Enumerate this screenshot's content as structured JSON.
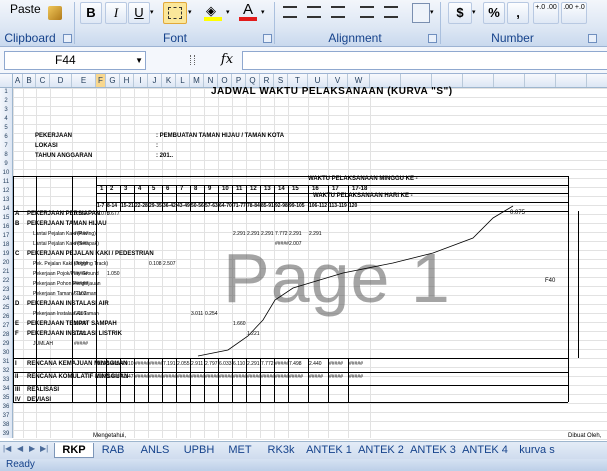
{
  "ribbon": {
    "paste_label": "Paste",
    "bold": "B",
    "italic": "I",
    "underline": "U",
    "font_color_glyph": "A",
    "groups": {
      "clipboard": "Clipboard",
      "font": "Font",
      "alignment": "Alignment",
      "number": "Number"
    },
    "number_buttons": {
      "currency": "$",
      "percent": "%",
      "comma": ",",
      "inc_dec": "+.0 .00",
      "dec_dec": ".00 +.0"
    }
  },
  "formula_bar": {
    "name_box": "F44",
    "fx": "fx",
    "formula": ""
  },
  "columns": [
    "A",
    "B",
    "C",
    "D",
    "E",
    "F",
    "G",
    "H",
    "I",
    "J",
    "K",
    "L",
    "M",
    "N",
    "O",
    "P",
    "Q",
    "R",
    "S",
    "T",
    "U",
    "V",
    "W"
  ],
  "rows": [
    "1",
    "2",
    "3",
    "4",
    "5",
    "6",
    "7",
    "8",
    "9",
    "10",
    "11",
    "12",
    "13",
    "14",
    "15",
    "16",
    "17",
    "18",
    "19",
    "20",
    "21",
    "22",
    "23",
    "24",
    "25",
    "26",
    "27",
    "28",
    "29",
    "30",
    "31",
    "32",
    "33",
    "34",
    "35",
    "36",
    "37",
    "38",
    "39"
  ],
  "sheet": {
    "title": "JADWAL WAKTU PELAKSANAAN (KURVA \"S\")",
    "info": [
      {
        "label": "PEKERJAAN",
        "value": ": PEMBUATAN TAMAN HIJAU / TAMAN KOTA"
      },
      {
        "label": "LOKASI",
        "value": ":"
      },
      {
        "label": "TAHUN ANGGARAN",
        "value": ": 201.."
      }
    ],
    "hdr_week": "WAKTU PELAKSANAAN MINGGU KE -",
    "hdr_day": "WAKTU PELAKSANAAN HARI KE -",
    "weeks": [
      "1",
      "2",
      "3",
      "4",
      "5",
      "6",
      "7",
      "8",
      "9",
      "10",
      "11",
      "12",
      "13",
      "14",
      "15",
      "16",
      "17",
      "17-18"
    ],
    "days": [
      "1-7",
      "8-14",
      "15-21",
      "22-28",
      "29-35",
      "36-42",
      "43-49",
      "50-56",
      "57-63",
      "64-70",
      "71-77",
      "78-84",
      "85-91",
      "92-98",
      "99-105",
      "106-112",
      "113-119",
      "120"
    ],
    "items": [
      {
        "no": "A",
        "name": "PEKERJAAN PERSIAPAN",
        "w": "0.751",
        "v": [
          "0.075",
          "0.677"
        ]
      },
      {
        "no": "B",
        "name": "PEKERJAAN TAMAN HIJAU",
        "w": "",
        "v": []
      },
      {
        "no": "",
        "name": "Lantai Pejalan Kaki (Paving)",
        "w": "#####",
        "v": [
          "2.291",
          "2.291",
          "2.291",
          "7.772",
          "2.291",
          "2.291"
        ]
      },
      {
        "no": "",
        "name": "Lantai Pejalan Kaki (Setapak)",
        "w": "#####",
        "v": [
          "#####",
          "2.007"
        ]
      },
      {
        "no": "C",
        "name": "PEKERJAAN PEJALAN KAKI / PEDESTRIAN",
        "w": "",
        "v": []
      },
      {
        "no": "",
        "name": "Pek. Pejalan Kaki (Jogging Track)",
        "w": "#####",
        "v": [
          "0.108",
          "2.507"
        ]
      },
      {
        "no": "",
        "name": "Pekerjaan Pojok/Play Ground",
        "w": "#####",
        "v": [
          "1.050"
        ]
      },
      {
        "no": "",
        "name": "Pekerjaan Pohon Penghijauan",
        "w": "#####",
        "v": []
      },
      {
        "no": "",
        "name": "Pekerjaan Taman / Tanaman",
        "w": "6.102",
        "v": []
      },
      {
        "no": "D",
        "name": "PEKERJAAN INSTALASI AIR",
        "w": "",
        "v": []
      },
      {
        "no": "",
        "name": "Pekerjaan Instalasi Air Taman",
        "w": "6.116",
        "v": [
          "3.011",
          "0.254"
        ]
      },
      {
        "no": "E",
        "name": "PEKERJAAN TEMPAT SAMPAH",
        "w": "1.660",
        "v": [
          "1.660"
        ]
      },
      {
        "no": "F",
        "name": "PEKERJAAN INSTALASI LISTRIK",
        "w": "1.221",
        "v": [
          "1.221"
        ]
      },
      {
        "no": "",
        "name": "JUMLAH",
        "w": "#####",
        "v": []
      }
    ],
    "summary": [
      {
        "no": "I",
        "name": "RENCANA KEMAJUAN MINGGUAN",
        "v": [
          "0.075",
          "1.405",
          "4.910",
          "#####",
          "#####",
          "7.191",
          "2.055",
          "2.911",
          "2.797",
          "6.033",
          "6.110",
          "2.291",
          "7.772",
          "#####",
          "7.498",
          "2.440",
          "#####",
          "#####"
        ]
      },
      {
        "no": "II",
        "name": "RENCANA KOMULATIF MINGGUAN",
        "v": [
          "0.075",
          "1.476",
          "6.347",
          "#####",
          "#####",
          "#####",
          "#####",
          "#####",
          "#####",
          "#####",
          "#####",
          "#####",
          "#####",
          "#####",
          "#####",
          "#####",
          "#####",
          "#####"
        ]
      },
      {
        "no": "III",
        "name": "REALISASI",
        "v": []
      },
      {
        "no": "IV",
        "name": "DEVIASI",
        "v": []
      }
    ],
    "pct_label": "F40",
    "top_cum": "0.075",
    "footer_left": "Mengetahui,",
    "footer_right": "Dibuat Oleh,",
    "watermark": "Page 1"
  },
  "tabs": [
    "RKP",
    "RAB",
    "ANLS",
    "UPBH",
    "MET",
    "RK3k",
    "ANTEK 1",
    "ANTEK 2",
    "ANTEK 3",
    "ANTEK 4",
    "kurva s"
  ],
  "active_tab": "RKP",
  "status": {
    "ready": "Ready"
  }
}
